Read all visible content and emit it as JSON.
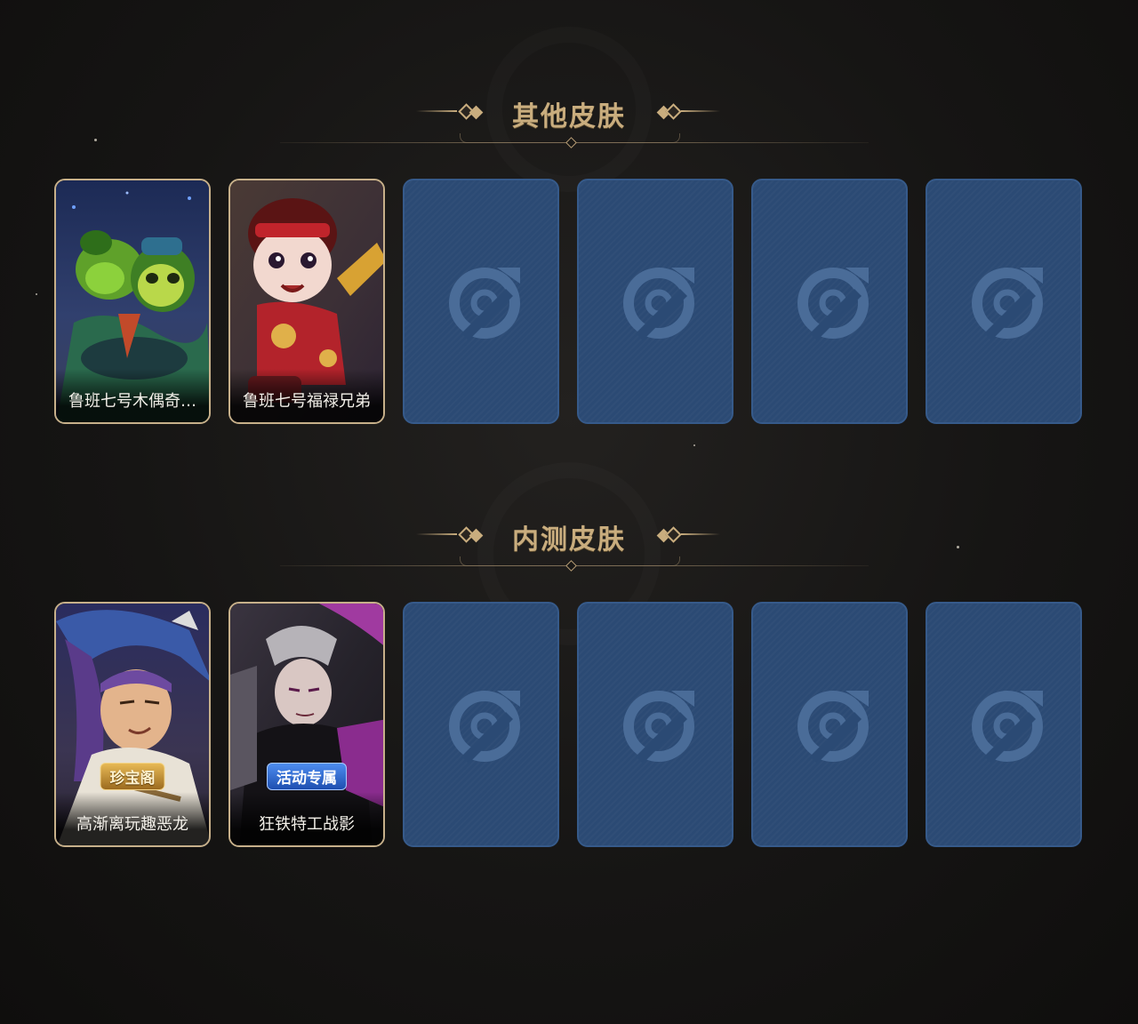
{
  "sections": [
    {
      "title": "其他皮肤",
      "cards": [
        {
          "name": "鲁班七号木偶奇…",
          "empty": false,
          "badge": ""
        },
        {
          "name": "鲁班七号福禄兄弟",
          "empty": false,
          "badge": ""
        },
        {
          "empty": true
        },
        {
          "empty": true
        },
        {
          "empty": true
        },
        {
          "empty": true
        }
      ]
    },
    {
      "title": "内测皮肤",
      "cards": [
        {
          "name": "高渐离玩趣恶龙",
          "empty": false,
          "badge": "珍宝阁"
        },
        {
          "name": "狂铁特工战影",
          "empty": false,
          "badge": "活动专属"
        },
        {
          "empty": true
        },
        {
          "empty": true
        },
        {
          "empty": true
        },
        {
          "empty": true
        }
      ]
    }
  ],
  "colors": {
    "accent_gold": "#c9ad7e",
    "empty_card": "#2b4a74",
    "background": "#161514"
  },
  "icons": {
    "empty_slot": "swirl-emblem-icon"
  }
}
